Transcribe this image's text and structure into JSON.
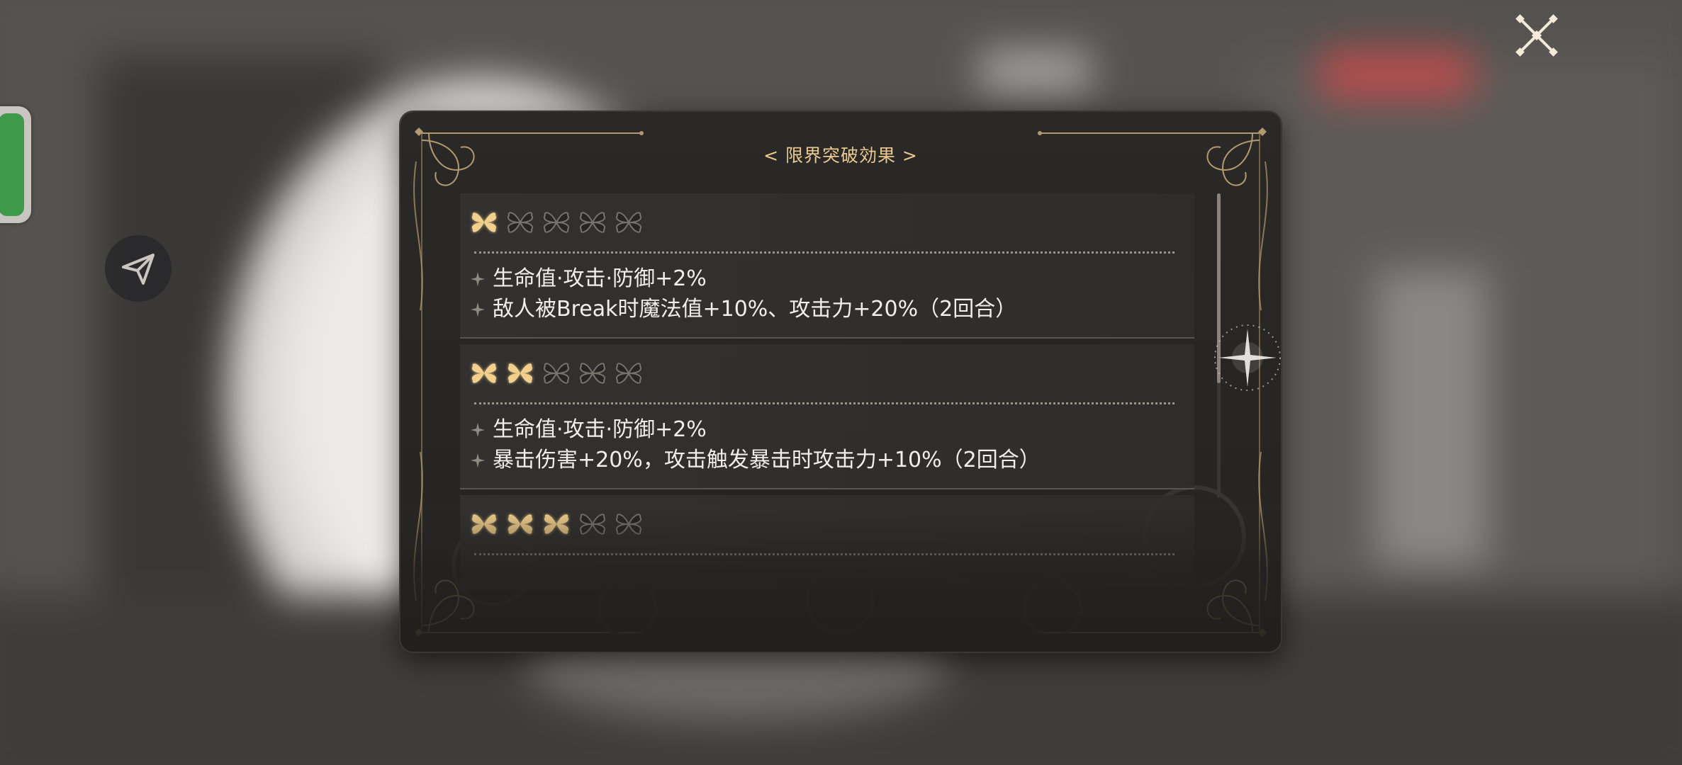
{
  "dialog": {
    "title": "< 限界突破効果 >",
    "entries": [
      {
        "level": 1,
        "max_level": 5,
        "effects": [
          "生命值·攻击·防御+2%",
          "敌人被Break时魔法值+10%、攻击力+20%（2回合）"
        ]
      },
      {
        "level": 2,
        "max_level": 5,
        "effects": [
          "生命值·攻击·防御+2%",
          "暴击伤害+20%，攻击触发暴击时攻击力+10%（2回合）"
        ]
      },
      {
        "level": 3,
        "max_level": 5,
        "effects": []
      }
    ]
  },
  "icons": {
    "close": "close-x-icon",
    "share": "share-arrow-icon",
    "star_filled": "gold-clover-star-icon",
    "star_empty": "empty-clover-star-icon",
    "bullet": "diamond-sparkle-bullet-icon"
  },
  "colors": {
    "title": "#e9c98f",
    "gold": "#f2cf8c",
    "text": "#f1efe9",
    "panel": "#2a2826",
    "frame": "#b39a6e"
  }
}
